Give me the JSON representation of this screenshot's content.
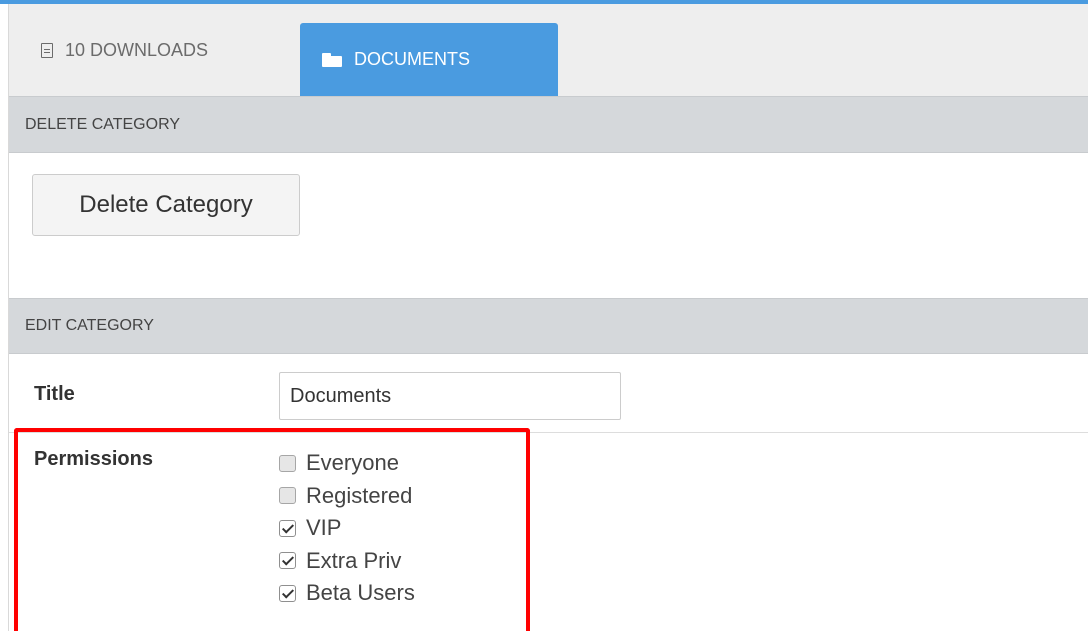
{
  "tabs": [
    {
      "label": "10 DOWNLOADS",
      "icon": "document-icon",
      "active": false
    },
    {
      "label": "DOCUMENTS",
      "icon": "folder-icon",
      "active": true
    }
  ],
  "delete_section": {
    "header": "DELETE CATEGORY",
    "button_label": "Delete Category"
  },
  "edit_section": {
    "header": "EDIT CATEGORY",
    "title_label": "Title",
    "title_value": "Documents",
    "permissions_label": "Permissions",
    "permissions": [
      {
        "label": "Everyone",
        "checked": false
      },
      {
        "label": "Registered",
        "checked": false
      },
      {
        "label": "VIP",
        "checked": true
      },
      {
        "label": "Extra Priv",
        "checked": true
      },
      {
        "label": "Beta Users",
        "checked": true
      }
    ]
  },
  "colors": {
    "accent": "#4a9be0",
    "section_header_bg": "#d5d8db",
    "highlight": "#ff0000"
  }
}
